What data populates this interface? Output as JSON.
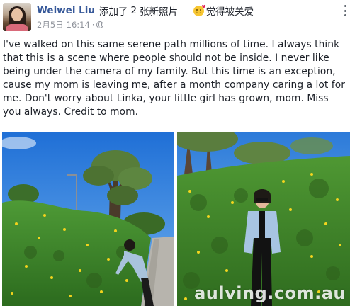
{
  "post": {
    "author_name": "Weiwei Liu",
    "action_prefix": "添加了",
    "photo_count": "2",
    "action_suffix": "张新照片",
    "dash": "—",
    "feeling": "觉得被关爱",
    "date": "2月5日",
    "time": "16:14",
    "separator": "·",
    "privacy_icon": "globe-icon",
    "feeling_icon": "smiling-face-with-heart-icon",
    "body": "I've walked on this same serene path millions of time. I always think that this is a scene where people should not be inside. I never like being under the camera of my family. But this time is an exception, cause my mom is leaving me, after a month company caring a lot for me. Don't worry about Linka, your little girl has grown, mom. Miss you always. Credit to mom."
  },
  "photos": [
    {
      "subject": "woman bending to touch flowers on path"
    },
    {
      "subject": "woman standing in front of flowering hedge"
    }
  ],
  "watermark": "aulving.com.au",
  "colors": {
    "author_link": "#365899",
    "meta_text": "#90949c",
    "body_text": "#1d2129",
    "sky": "#2f7de0",
    "hedge": "#3f8a2c"
  }
}
